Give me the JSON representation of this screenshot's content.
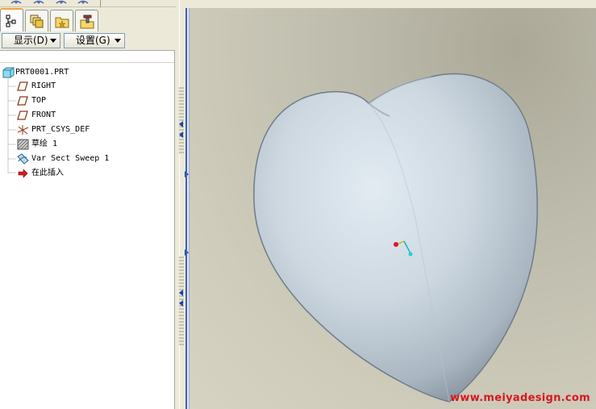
{
  "tabs": [
    {
      "name": "model-tree",
      "icon": "model-tree-icon",
      "active": true
    },
    {
      "name": "layers",
      "icon": "layers-icon",
      "active": false
    },
    {
      "name": "favorites",
      "icon": "favorites-folder-icon",
      "active": false
    },
    {
      "name": "tools",
      "icon": "tools-icon",
      "active": false
    }
  ],
  "toolbar": {
    "show_label": "显示(D)",
    "settings_label": "设置(G)"
  },
  "tree": {
    "root": {
      "label": "PRT0001.PRT",
      "icon": "part-icon"
    },
    "items": [
      {
        "label": "RIGHT",
        "icon": "datum-plane-icon"
      },
      {
        "label": "TOP",
        "icon": "datum-plane-icon"
      },
      {
        "label": "FRONT",
        "icon": "datum-plane-icon"
      },
      {
        "label": "PRT_CSYS_DEF",
        "icon": "coordinate-system-icon"
      },
      {
        "label": "草绘 1",
        "icon": "sketch-icon"
      },
      {
        "label": "Var Sect Sweep 1",
        "icon": "sweep-icon"
      },
      {
        "label": "在此插入",
        "icon": "insert-here-arrow-icon"
      }
    ]
  },
  "viewport": {
    "model": "heart-shaped-solid",
    "watermark": "www.meiyadesign.com"
  },
  "colors": {
    "panel_bg": "#ece9d8",
    "tab_highlight": "#f2a33a",
    "model_surface": "#c9d5df",
    "watermark": "#d8181d",
    "rail": "#3c5fc4"
  }
}
